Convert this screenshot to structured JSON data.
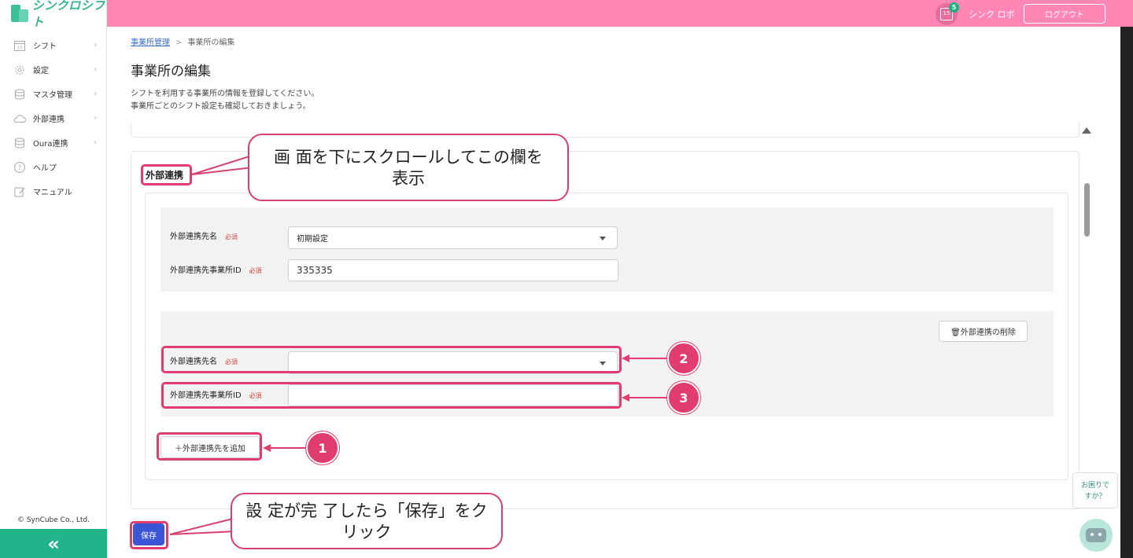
{
  "app": {
    "logo_text": "シンクロシフト",
    "copyright": "© SynCube Co., Ltd.",
    "collapse_glyph": "«"
  },
  "sidebar": {
    "items": [
      {
        "label": "シフト",
        "icon": "calendar-icon"
      },
      {
        "label": "設定",
        "icon": "gear-icon"
      },
      {
        "label": "マスタ管理",
        "icon": "database-icon"
      },
      {
        "label": "外部連携",
        "icon": "cloud-icon"
      },
      {
        "label": "Oura連携",
        "icon": "database-icon"
      },
      {
        "label": "ヘルプ",
        "icon": "question-icon"
      },
      {
        "label": "マニュアル",
        "icon": "edit-icon"
      }
    ]
  },
  "header": {
    "calendar_label": "15",
    "notification_count": "5",
    "user_name": "シンク ロボ",
    "logout_label": "ログアウト",
    "accent_color": "#ff86b5"
  },
  "breadcrumb": {
    "parent": "事業所管理",
    "separator": ">",
    "current": "事業所の編集"
  },
  "page": {
    "title": "事業所の編集",
    "desc_line1": "シフトを利用する事業所の情報を登録してください。",
    "desc_line2": "事業所ごとのシフト設定も確認しておきましょう。"
  },
  "section": {
    "title": "外部連携",
    "field_name_label": "外部連携先名",
    "field_id_label": "外部連携先事業所ID",
    "required_label": "必須",
    "block1": {
      "select_value": "初期設定",
      "id_value": "335335"
    },
    "block2": {
      "select_value": "",
      "id_value": ""
    },
    "delete_label": "🗑外部連携の削除",
    "add_label": "＋外部連携先を追加"
  },
  "save_label": "保存",
  "help": {
    "line1": "お困りで",
    "line2": "すか？"
  },
  "annotations": {
    "callout_top_line1": "画 面を下にスクロールしてこの欄を",
    "callout_top_line2": "表示",
    "callout_bottom_line1": "設 定が完 了したら「保存」をク",
    "callout_bottom_line2": "リック",
    "num1": "1",
    "num2": "2",
    "num3": "3",
    "color": "#e03c6d"
  }
}
